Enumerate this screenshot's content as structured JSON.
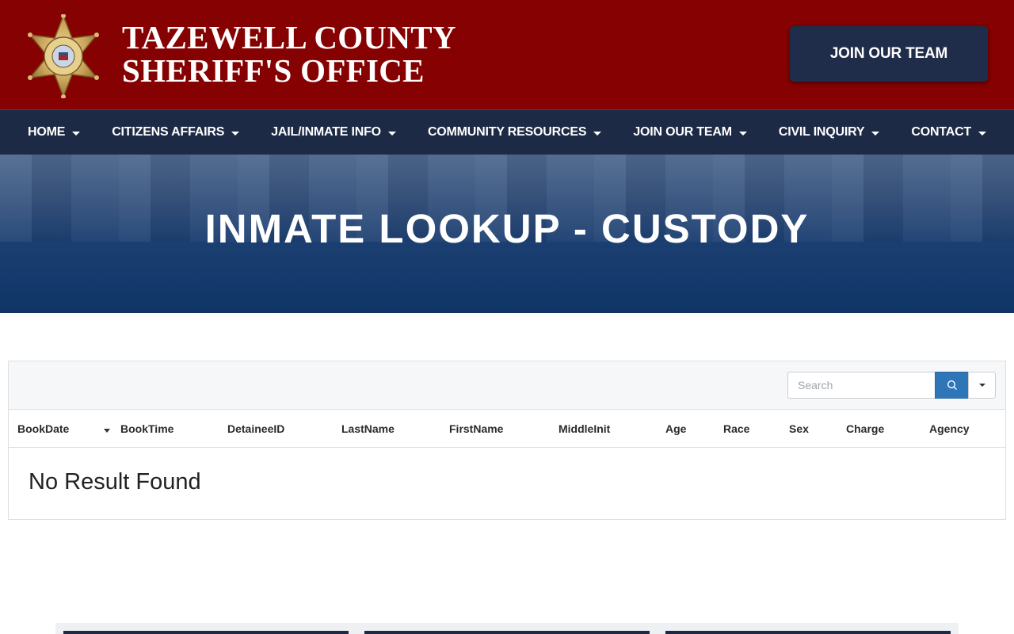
{
  "header": {
    "title_line1": "TAZEWELL COUNTY",
    "title_line2": "SHERIFF'S OFFICE",
    "join_button": "JOIN OUR TEAM",
    "logo_icon": "sheriff-star-badge-icon",
    "colors": {
      "header_bg": "#860101",
      "nav_bg": "#1d2a45",
      "button_bg": "#1f2d4a"
    }
  },
  "nav": {
    "items": [
      {
        "label": "HOME"
      },
      {
        "label": "CITIZENS AFFAIRS"
      },
      {
        "label": "JAIL/INMATE INFO"
      },
      {
        "label": "COMMUNITY RESOURCES"
      },
      {
        "label": "JOIN OUR TEAM"
      },
      {
        "label": "CIVIL INQUIRY"
      },
      {
        "label": "CONTACT"
      }
    ]
  },
  "hero": {
    "title": "INMATE LOOKUP - CUSTODY"
  },
  "table": {
    "search_placeholder": "Search",
    "search_icon": "search-icon",
    "columns": [
      "BookDate",
      "BookTime",
      "DetaineeID",
      "LastName",
      "FirstName",
      "MiddleInit",
      "Age",
      "Race",
      "Sex",
      "Charge",
      "Agency"
    ],
    "sorted_column": "BookDate",
    "empty_message": "No Result Found",
    "accent_color": "#2f76b8"
  }
}
